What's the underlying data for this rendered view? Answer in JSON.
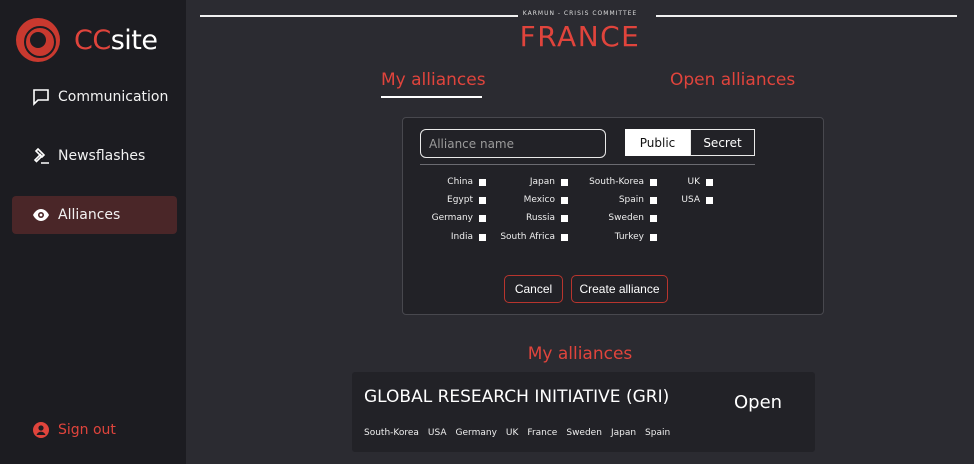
{
  "brand": {
    "prefix": "CC",
    "suffix": "site"
  },
  "nav": {
    "items": [
      {
        "label": "Communication",
        "icon": "chat-icon"
      },
      {
        "label": "Newsflashes",
        "icon": "gavel-icon"
      },
      {
        "label": "Alliances",
        "icon": "eye-icon",
        "active": true
      }
    ],
    "signout": {
      "label": "Sign out",
      "icon": "user-circle-icon"
    }
  },
  "header": {
    "committee": "KARMUN - CRISIS COMMITTEE",
    "country": "FRANCE"
  },
  "tabs": {
    "my": "My alliances",
    "open": "Open alliances",
    "active": "my"
  },
  "form": {
    "name_placeholder": "Alliance name",
    "name_value": "",
    "visibility": {
      "public": "Public",
      "secret": "Secret",
      "selected": "Public"
    },
    "countries": [
      [
        "China",
        "Japan",
        "South-Korea",
        "UK"
      ],
      [
        "Egypt",
        "Mexico",
        "Spain",
        "USA"
      ],
      [
        "Germany",
        "Russia",
        "Sweden",
        ""
      ],
      [
        "India",
        "South Africa",
        "Turkey",
        ""
      ]
    ],
    "cancel": "Cancel",
    "create": "Create alliance"
  },
  "list": {
    "title": "My alliances",
    "alliances": [
      {
        "name": "GLOBAL RESEARCH INITIATIVE (GRI)",
        "status": "Open",
        "members": [
          "South-Korea",
          "USA",
          "Germany",
          "UK",
          "France",
          "Sweden",
          "Japan",
          "Spain"
        ]
      }
    ]
  },
  "colors": {
    "accent": "#e0443c",
    "sidebar": "#1c1c21",
    "background": "#2b2b31",
    "active_nav": "#4a2628"
  }
}
